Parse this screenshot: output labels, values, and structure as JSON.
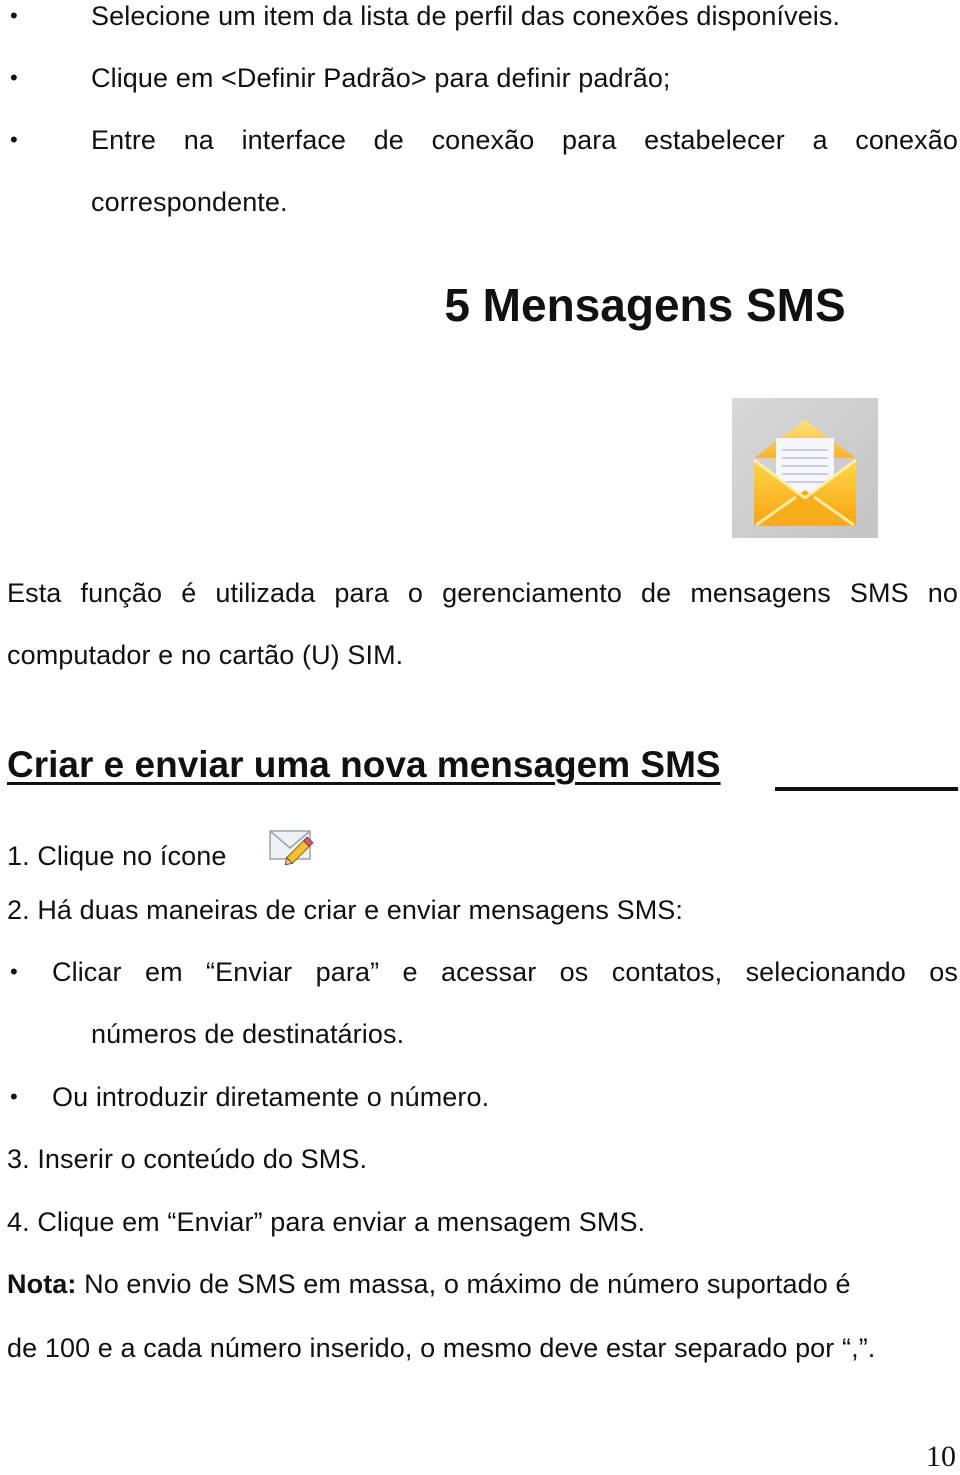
{
  "intro_bullets": [
    "Selecione um item da lista de perfil das conexões disponíveis.",
    "Clique em <Definir Padrão> para definir padrão;",
    "Entre na interface de conexão para estabelecer a conexão",
    "correspondente."
  ],
  "chapter": {
    "title": "5 Mensagens SMS",
    "icon": "open-envelope-icon"
  },
  "description": [
    "Esta função é utilizada para o gerenciamento de mensagens SMS no",
    "computador e no cartão (U) SIM."
  ],
  "section": {
    "heading": "Criar e enviar uma nova mensagem SMS",
    "steps": {
      "step1": "1. Clique no ícone",
      "step1_icon": "compose-envelope-pencil-icon",
      "step2": "2. Há duas maneiras de criar e enviar mensagens SMS:",
      "sub_bullets": [
        "Clicar em “Enviar para” e acessar os contatos, selecionando os",
        "números de destinatários.",
        "Ou introduzir diretamente o número."
      ],
      "step3": "3. Inserir o conteúdo do SMS.",
      "step4": "4. Clique em “Enviar” para enviar a mensagem SMS."
    },
    "note": {
      "label": "Nota:",
      "line1": " No envio de SMS em massa, o máximo de número suportado é",
      "line2": "de 100 e a cada número inserido, o mesmo deve estar separado por “,”."
    }
  },
  "bullet_char": "•",
  "page_number": "10"
}
